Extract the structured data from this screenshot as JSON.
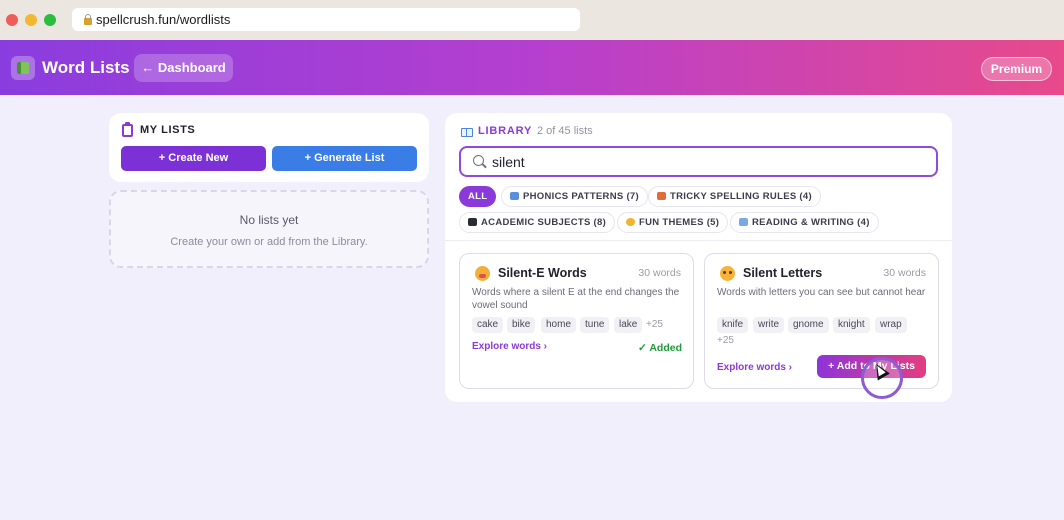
{
  "browser": {
    "url": "spellcrush.fun/wordlists"
  },
  "header": {
    "title": "Word Lists",
    "back_label": "← Dashboard",
    "premium_label": "Premium"
  },
  "my_lists": {
    "title": "MY LISTS",
    "create_label": "+ Create New",
    "generate_label": "+ Generate List",
    "empty_title": "No lists yet",
    "empty_subtitle": "Create your own or add from the Library."
  },
  "library": {
    "title": "LIBRARY",
    "count": "2 of 45 lists",
    "search_value": "silent",
    "filters": [
      {
        "label": "ALL"
      },
      {
        "label": "PHONICS PATTERNS (7)",
        "icon": "abc-icon"
      },
      {
        "label": "TRICKY SPELLING RULES (4)",
        "icon": "pencil-icon"
      },
      {
        "label": "ACADEMIC SUBJECTS (8)",
        "icon": "graduation-cap-icon"
      },
      {
        "label": "FUN THEMES (5)",
        "icon": "smiley-icon"
      },
      {
        "label": "READING & WRITING (4)",
        "icon": "book-icon"
      }
    ],
    "cards": [
      {
        "title": "Silent-E Words",
        "count": "30 words",
        "description": "Words where a silent E at the end changes the vowel sound",
        "tags": [
          "cake",
          "bike",
          "home",
          "tune",
          "lake"
        ],
        "more": "+25",
        "explore": "Explore words ›",
        "status": "✓ Added",
        "icon": "shushing-face-icon"
      },
      {
        "title": "Silent Letters",
        "count": "30 words",
        "description": "Words with letters you can see but cannot hear",
        "tags": [
          "knife",
          "write",
          "gnome",
          "knight",
          "wrap"
        ],
        "more": "+25",
        "explore": "Explore words ›",
        "action": "+ Add to My Lists",
        "icon": "eyes-face-icon"
      }
    ]
  },
  "colors": {
    "accent_purple": "#8b3ad9",
    "accent_blue": "#3a7de7",
    "success_green": "#1f9a3a",
    "header_gradient_start": "#8a3dde",
    "header_gradient_end": "#e84a8b"
  }
}
